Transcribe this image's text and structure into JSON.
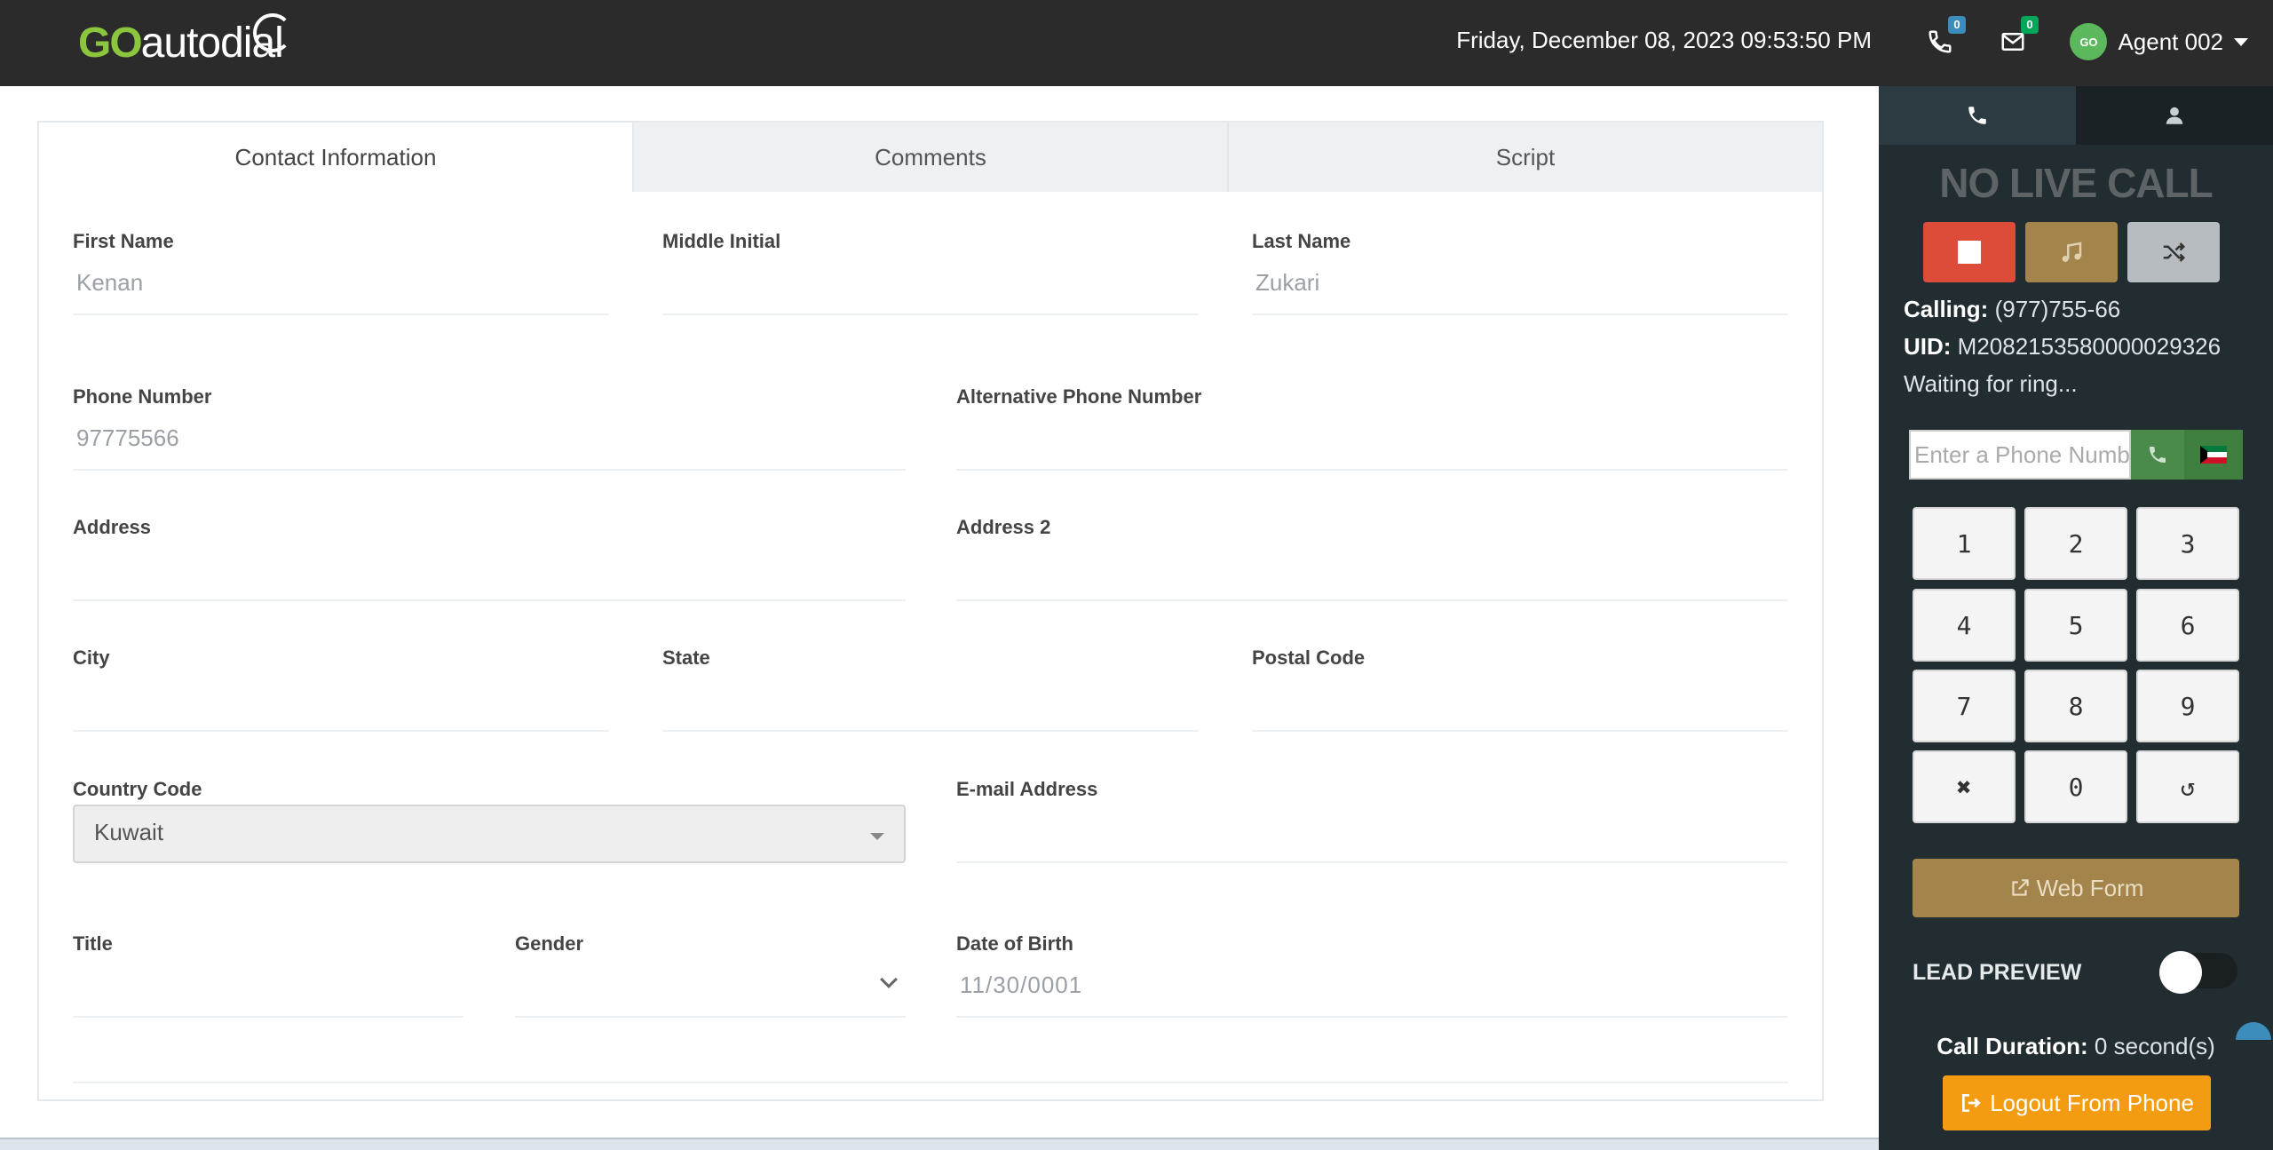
{
  "header": {
    "logo_go": "GO",
    "logo_rest": "autodial",
    "datetime": "Friday, December 08, 2023 09:53:50 PM",
    "calls_badge": "0",
    "messages_badge": "0",
    "agent_initials": "GO",
    "agent_name": "Agent 002"
  },
  "tabs": [
    {
      "label": "Contact Information"
    },
    {
      "label": "Comments"
    },
    {
      "label": "Script"
    }
  ],
  "form": {
    "first_name": {
      "label": "First Name",
      "value": "Kenan"
    },
    "middle_initial": {
      "label": "Middle Initial",
      "value": ""
    },
    "last_name": {
      "label": "Last Name",
      "value": "Zukari"
    },
    "phone_number": {
      "label": "Phone Number",
      "value": "97775566"
    },
    "alt_phone": {
      "label": "Alternative Phone Number",
      "value": ""
    },
    "address": {
      "label": "Address",
      "value": ""
    },
    "address2": {
      "label": "Address 2",
      "value": ""
    },
    "city": {
      "label": "City",
      "value": ""
    },
    "state": {
      "label": "State",
      "value": ""
    },
    "postal_code": {
      "label": "Postal Code",
      "value": ""
    },
    "country_code": {
      "label": "Country Code",
      "value": "Kuwait"
    },
    "email": {
      "label": "E-mail Address",
      "value": ""
    },
    "title": {
      "label": "Title",
      "value": ""
    },
    "gender": {
      "label": "Gender",
      "value": ""
    },
    "dob": {
      "label": "Date of Birth",
      "value": "11/30/0001"
    }
  },
  "side": {
    "status": "NO LIVE CALL",
    "calling_label": "Calling:",
    "calling_value": "(977)755-66",
    "uid_label": "UID:",
    "uid_value": "M2082153580000029326",
    "waiting": "Waiting for ring...",
    "phone_placeholder": "Enter a Phone Number",
    "keys": [
      "1",
      "2",
      "3",
      "4",
      "5",
      "6",
      "7",
      "8",
      "9",
      "✖",
      "0",
      "↺"
    ],
    "webform_label": "Web Form",
    "lead_preview": "LEAD PREVIEW",
    "lead_preview_on": false,
    "call_duration_label": "Call Duration:",
    "call_duration_value": "0 second(s)",
    "logout_label": "Logout From Phone"
  },
  "colors": {
    "topbar": "#2b2b2b",
    "sidebar": "#222d32",
    "hangup": "#dd4b39",
    "music": "#a3844a",
    "shuffle": "#b6bcc0",
    "logout": "#f39c12",
    "logo_green": "#8cc63f"
  }
}
